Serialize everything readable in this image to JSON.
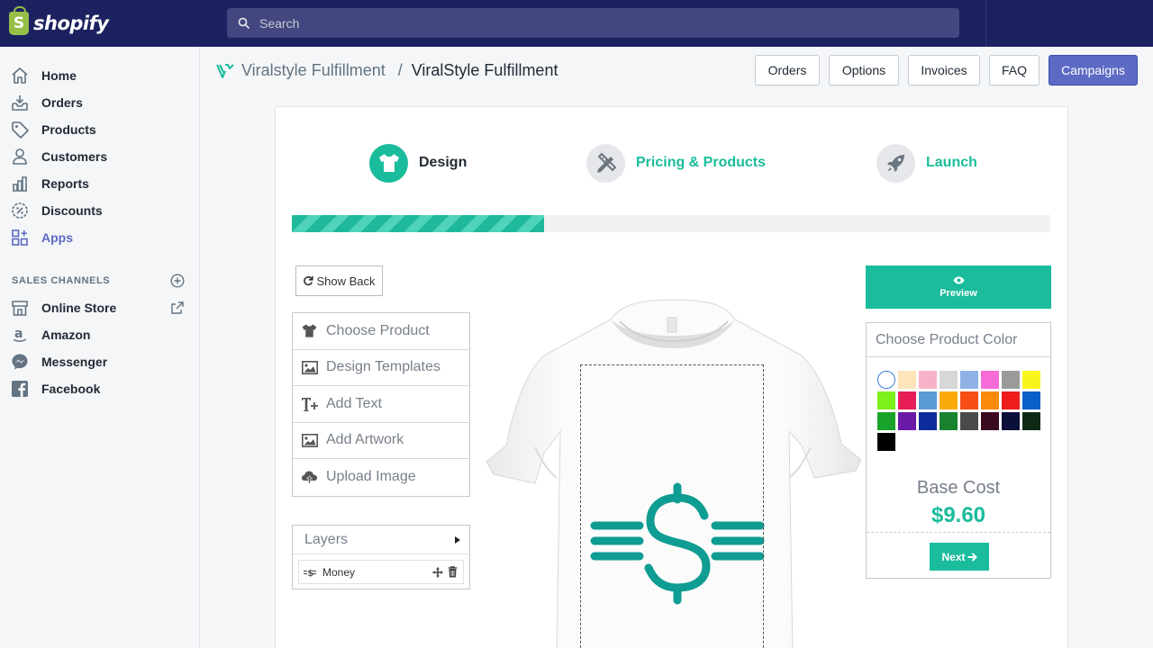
{
  "brand": {
    "name": "shopify",
    "logo_glyph": "S"
  },
  "search": {
    "placeholder": "Search"
  },
  "sidebar": {
    "items": [
      {
        "label": "Home",
        "icon": "home-icon",
        "active": false
      },
      {
        "label": "Orders",
        "icon": "orders-icon",
        "active": false
      },
      {
        "label": "Products",
        "icon": "tag-icon",
        "active": false
      },
      {
        "label": "Customers",
        "icon": "user-icon",
        "active": false
      },
      {
        "label": "Reports",
        "icon": "bar-chart-icon",
        "active": false
      },
      {
        "label": "Discounts",
        "icon": "discount-icon",
        "active": false
      },
      {
        "label": "Apps",
        "icon": "apps-icon",
        "active": true
      }
    ],
    "sales_channels_title": "SALES CHANNELS",
    "channels": [
      {
        "label": "Online Store",
        "icon": "store-icon"
      },
      {
        "label": "Amazon",
        "icon": "amazon-icon"
      },
      {
        "label": "Messenger",
        "icon": "messenger-icon"
      },
      {
        "label": "Facebook",
        "icon": "facebook-icon"
      }
    ]
  },
  "header": {
    "app_name": "Viralstyle Fulfillment",
    "separator": "/",
    "page_title": "ViralStyle Fulfillment",
    "buttons": [
      "Orders",
      "Options",
      "Invoices",
      "FAQ",
      "Campaigns"
    ]
  },
  "steps": [
    {
      "label": "Design",
      "icon": "tshirt-icon",
      "active": true
    },
    {
      "label": "Pricing & Products",
      "icon": "pencil-ruler-icon",
      "active": false
    },
    {
      "label": "Launch",
      "icon": "rocket-icon",
      "active": false
    }
  ],
  "progress_fraction": 0.333,
  "designer": {
    "show_back": "Show Back",
    "tools": [
      {
        "label": "Choose Product",
        "icon": "tshirt-icon"
      },
      {
        "label": "Design Templates",
        "icon": "image-icon"
      },
      {
        "label": "Add Text",
        "icon": "text-plus-icon"
      },
      {
        "label": "Add Artwork",
        "icon": "image-icon"
      },
      {
        "label": "Upload Image",
        "icon": "cloud-upload-icon"
      }
    ],
    "layers_title": "Layers",
    "layers": [
      {
        "name": "Money"
      }
    ],
    "preview_label": "Preview",
    "color_panel_title": "Choose Product Color",
    "colors": [
      "#ffffff",
      "#fde5b9",
      "#f7b2c8",
      "#d7d7d7",
      "#8fb2e6",
      "#f76bd8",
      "#9a9a9a",
      "#f9f51c",
      "#7ef01b",
      "#e71d58",
      "#5a9bd5",
      "#f9a90a",
      "#f74e15",
      "#f98a0b",
      "#ee1c1c",
      "#0b5fc9",
      "#18a42a",
      "#6a1aa7",
      "#0d2b9a",
      "#18822e",
      "#4a4a4a",
      "#3a0a1e",
      "#0b0f3a",
      "#0e2a16",
      "#000000"
    ],
    "base_cost_label": "Base Cost",
    "base_cost": "$9.60",
    "next_label": "Next"
  },
  "colors": {
    "accent": "#1abc9c",
    "topbar": "#1c2260",
    "primary_button": "#5c6ac4"
  }
}
